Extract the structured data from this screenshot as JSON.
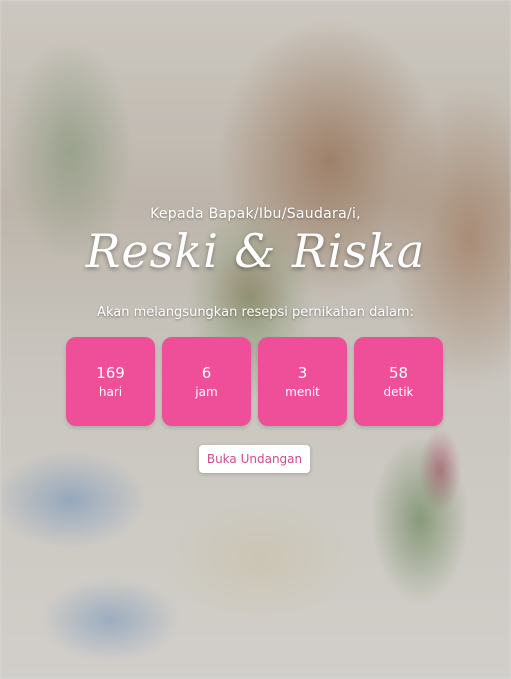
{
  "invitation": {
    "greeting": "Kepada Bapak/Ibu/Saudara/i,",
    "couple_names": "Reski & Riska",
    "announcement": "Akan melangsungkan resepsi pernikahan dalam:",
    "countdown": [
      {
        "value": "169",
        "unit": "hari"
      },
      {
        "value": "6",
        "unit": "jam"
      },
      {
        "value": "3",
        "unit": "menit"
      },
      {
        "value": "58",
        "unit": "detik"
      }
    ],
    "open_button": "Buka Undangan"
  },
  "colors": {
    "accent": "#ee4f98",
    "button_text": "#d14b8a"
  }
}
